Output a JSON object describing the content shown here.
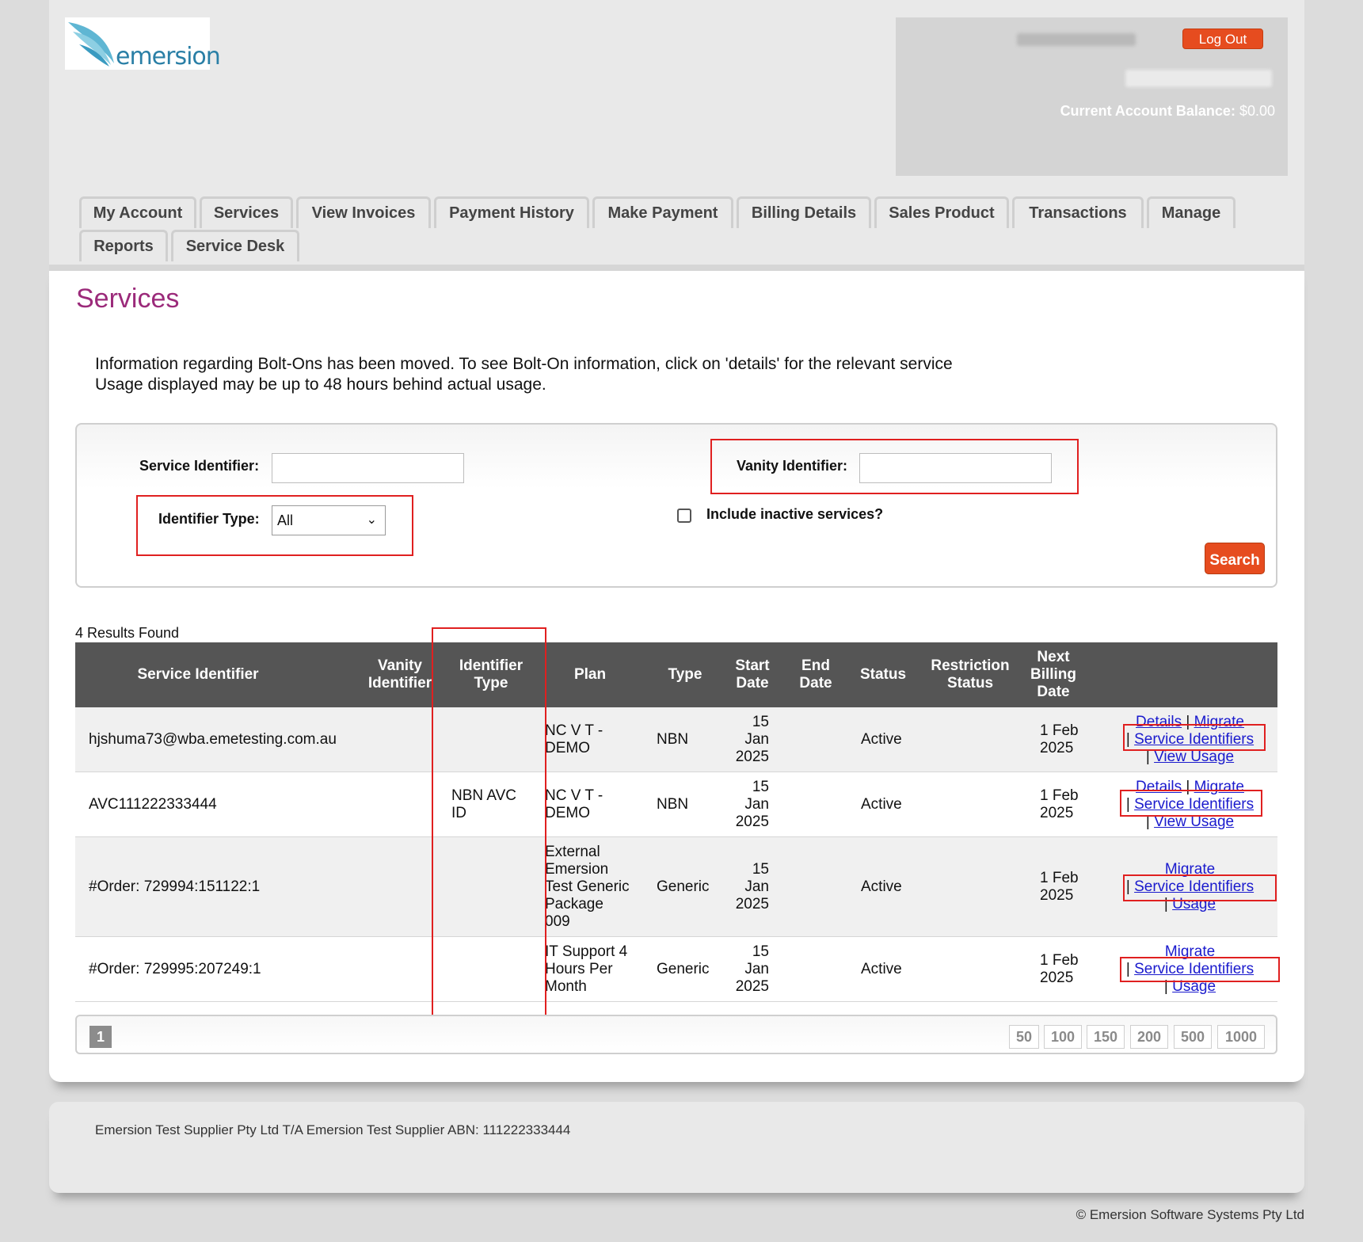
{
  "header": {
    "logo_text": "emersion",
    "logout_label": "Log Out",
    "balance_label": "Current Account Balance:",
    "balance_value": "$0.00"
  },
  "tabs": [
    "My Account",
    "Services",
    "View Invoices",
    "Payment History",
    "Make Payment",
    "Billing Details",
    "Sales Product",
    "Transactions",
    "Manage",
    "Reports",
    "Service Desk"
  ],
  "page": {
    "title": "Services",
    "info_line1": "Information regarding Bolt-Ons has been moved. To see Bolt-On information, click on 'details' for the relevant service",
    "info_line2": "Usage displayed may be up to 48 hours behind actual usage."
  },
  "filters": {
    "service_identifier_label": "Service Identifier:",
    "service_identifier_value": "",
    "vanity_identifier_label": "Vanity Identifier:",
    "vanity_identifier_value": "",
    "identifier_type_label": "Identifier Type:",
    "identifier_type_value": "All",
    "include_inactive_label": "Include inactive services?",
    "search_label": "Search"
  },
  "results": {
    "count_text": "4 Results Found",
    "columns": {
      "service_identifier": "Service Identifier",
      "vanity_identifier": [
        "Vanity",
        "Identifier"
      ],
      "identifier_type": [
        "Identifier",
        "Type"
      ],
      "plan": "Plan",
      "type": "Type",
      "start_date": [
        "Start",
        "Date"
      ],
      "end_date": [
        "End",
        "Date"
      ],
      "status": "Status",
      "restriction_status": [
        "Restriction",
        "Status"
      ],
      "next_billing_date": [
        "Next",
        "Billing",
        "Date"
      ]
    },
    "rows": [
      {
        "service_identifier": "hjshuma73@wba.emetesting.com.au",
        "identifier_type": [
          "",
          ""
        ],
        "plan": [
          "NC V T -",
          "DEMO"
        ],
        "type": "NBN",
        "start_date": [
          "15",
          "Jan",
          "2025"
        ],
        "status": "Active",
        "next_billing": [
          "1 Feb",
          "2025"
        ],
        "links": {
          "details": "Details",
          "migrate": "Migrate",
          "service_identifiers": "Service Identifiers",
          "usage": "View Usage"
        }
      },
      {
        "service_identifier": "AVC111222333444",
        "identifier_type": [
          "NBN AVC",
          "ID"
        ],
        "plan": [
          "NC V T -",
          "DEMO"
        ],
        "type": "NBN",
        "start_date": [
          "15",
          "Jan",
          "2025"
        ],
        "status": "Active",
        "next_billing": [
          "1 Feb",
          "2025"
        ],
        "links": {
          "details": "Details",
          "migrate": "Migrate",
          "service_identifiers": "Service Identifiers",
          "usage": "View Usage"
        }
      },
      {
        "service_identifier": "#Order: 729994:151122:1",
        "identifier_type": [
          "",
          ""
        ],
        "plan": [
          "External",
          "Emersion",
          "Test Generic",
          "Package",
          "009"
        ],
        "type": "Generic",
        "start_date": [
          "15",
          "Jan",
          "2025"
        ],
        "status": "Active",
        "next_billing": [
          "1 Feb",
          "2025"
        ],
        "links": {
          "migrate": "Migrate",
          "service_identifiers": "Service Identifiers",
          "usage": "Usage"
        }
      },
      {
        "service_identifier": "#Order: 729995:207249:1",
        "identifier_type": [
          "",
          ""
        ],
        "plan": [
          "IT Support 4",
          "Hours Per",
          "Month"
        ],
        "type": "Generic",
        "start_date": [
          "15",
          "Jan",
          "2025"
        ],
        "status": "Active",
        "next_billing": [
          "1 Feb",
          "2025"
        ],
        "links": {
          "migrate": "Migrate",
          "service_identifiers": "Service Identifiers",
          "usage": "Usage"
        }
      }
    ]
  },
  "pagination": {
    "current_page": "1",
    "page_sizes": [
      "50",
      "100",
      "150",
      "200",
      "500",
      "1000"
    ]
  },
  "footer": {
    "company_text": "Emersion Test Supplier Pty Ltd T/A Emersion Test Supplier ABN: 111222333444",
    "copyright": "© Emersion Software Systems Pty Ltd"
  },
  "colors": {
    "accent": "#e64c1f",
    "title": "#9b2a7a",
    "table_header": "#555555",
    "link": "#1a1acd",
    "annotation": "#e02020"
  }
}
